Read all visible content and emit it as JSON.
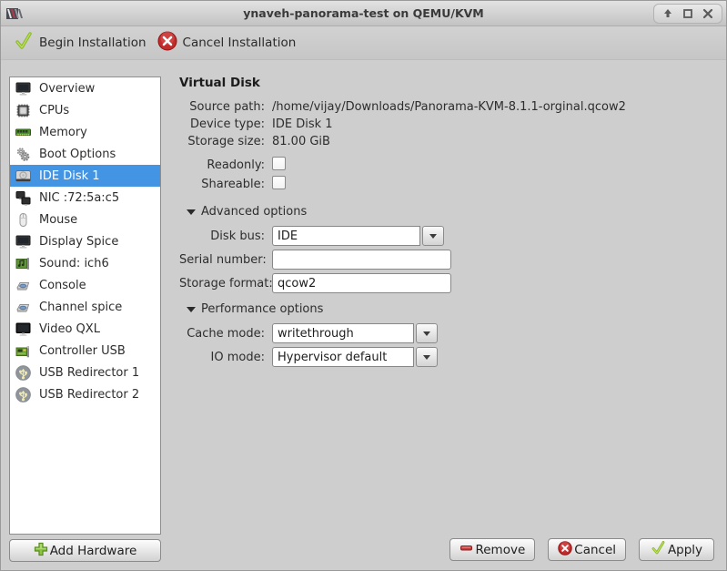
{
  "window": {
    "title": "ynaveh-panorama-test on QEMU/KVM",
    "controls": {
      "shade": "shade",
      "maximize": "maximize",
      "close": "close"
    }
  },
  "toolbar": {
    "begin_label": "Begin Installation",
    "cancel_label": "Cancel Installation"
  },
  "sidebar": {
    "items": [
      {
        "label": "Overview",
        "icon": "monitor-icon",
        "selected": false
      },
      {
        "label": "CPUs",
        "icon": "cpu-icon",
        "selected": false
      },
      {
        "label": "Memory",
        "icon": "memory-icon",
        "selected": false
      },
      {
        "label": "Boot Options",
        "icon": "gears-icon",
        "selected": false
      },
      {
        "label": "IDE Disk 1",
        "icon": "harddisk-icon",
        "selected": true
      },
      {
        "label": "NIC :72:5a:c5",
        "icon": "network-icon",
        "selected": false
      },
      {
        "label": "Mouse",
        "icon": "mouse-icon",
        "selected": false
      },
      {
        "label": "Display Spice",
        "icon": "monitor-icon",
        "selected": false
      },
      {
        "label": "Sound: ich6",
        "icon": "soundcard-icon",
        "selected": false
      },
      {
        "label": "Console",
        "icon": "serial-icon",
        "selected": false
      },
      {
        "label": "Channel spice",
        "icon": "serial-icon",
        "selected": false
      },
      {
        "label": "Video QXL",
        "icon": "video-icon",
        "selected": false
      },
      {
        "label": "Controller USB",
        "icon": "controller-icon",
        "selected": false
      },
      {
        "label": "USB Redirector 1",
        "icon": "usb-icon",
        "selected": false
      },
      {
        "label": "USB Redirector 2",
        "icon": "usb-icon",
        "selected": false
      }
    ],
    "add_hardware_label": "Add Hardware"
  },
  "main": {
    "title": "Virtual Disk",
    "source_path_label": "Source path:",
    "source_path_value": "/home/vijay/Downloads/Panorama-KVM-8.1.1-orginal.qcow2",
    "device_type_label": "Device type:",
    "device_type_value": "IDE Disk 1",
    "storage_size_label": "Storage size:",
    "storage_size_value": "81.00 GiB",
    "readonly_label": "Readonly:",
    "readonly_checked": false,
    "shareable_label": "Shareable:",
    "shareable_checked": false,
    "advanced": {
      "title": "Advanced options",
      "disk_bus_label": "Disk bus:",
      "disk_bus_value": "IDE",
      "serial_label": "Serial number:",
      "serial_value": "",
      "format_label": "Storage format:",
      "format_value": "qcow2"
    },
    "performance": {
      "title": "Performance options",
      "cache_label": "Cache mode:",
      "cache_value": "writethrough",
      "io_label": "IO mode:",
      "io_value": "Hypervisor default"
    }
  },
  "footer": {
    "remove_label": "Remove",
    "cancel_label": "Cancel",
    "apply_label": "Apply"
  },
  "colors": {
    "selection_blue": "#4494e4",
    "accent_green": "#73c116",
    "accent_red": "#cc2222",
    "window_bg": "#cecece"
  }
}
